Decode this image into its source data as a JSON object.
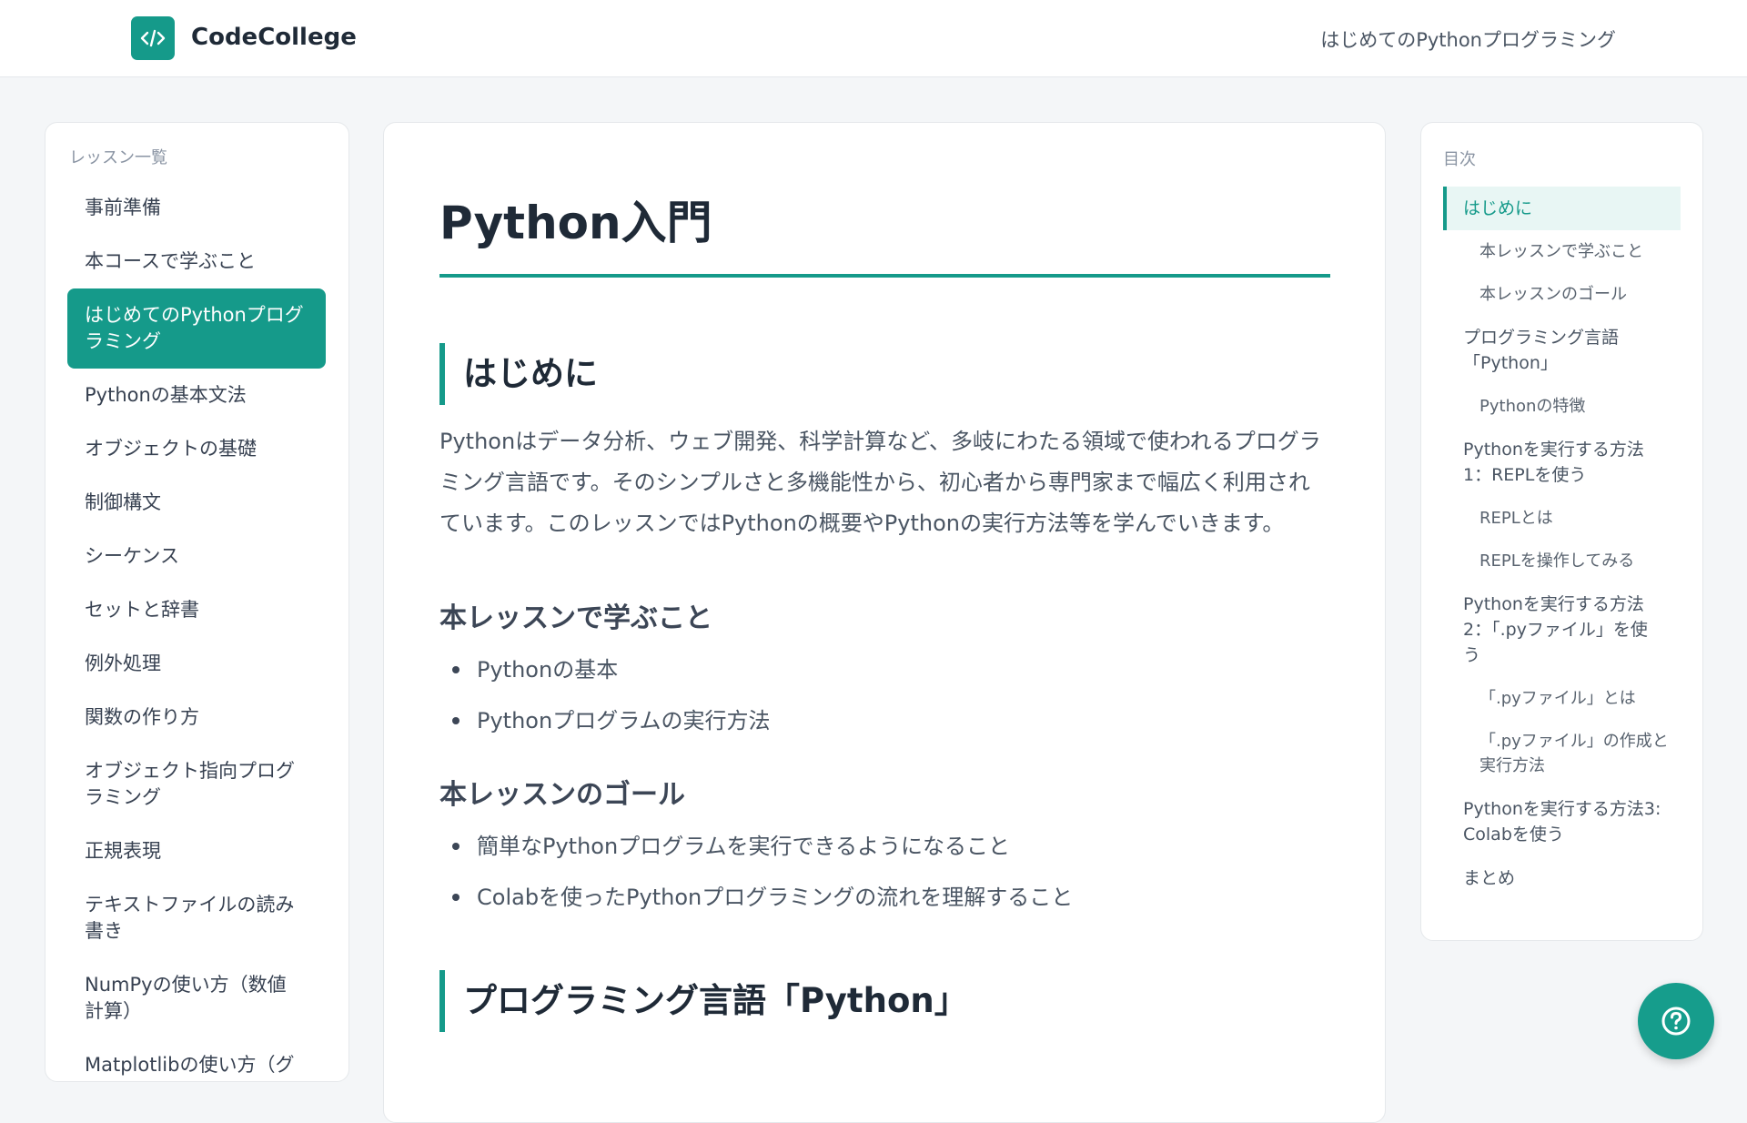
{
  "header": {
    "brand": "CodeCollege",
    "course_title": "はじめてのPythonプログラミング",
    "logo_icon": "code-icon"
  },
  "left_nav": {
    "heading": "レッスン一覧",
    "items": [
      {
        "label": "事前準備"
      },
      {
        "label": "本コースで学ぶこと"
      },
      {
        "label": "はじめてのPythonプログラミング",
        "active": true
      },
      {
        "label": "Pythonの基本文法"
      },
      {
        "label": "オブジェクトの基礎"
      },
      {
        "label": "制御構文"
      },
      {
        "label": "シーケンス"
      },
      {
        "label": "セットと辞書"
      },
      {
        "label": "例外処理"
      },
      {
        "label": "関数の作り方"
      },
      {
        "label": "オブジェクト指向プログラミング"
      },
      {
        "label": "正規表現"
      },
      {
        "label": "テキストファイルの読み書き"
      },
      {
        "label": "NumPyの使い方（数値計算）"
      },
      {
        "label": "Matplotlibの使い方（グラ"
      }
    ]
  },
  "main": {
    "title": "Python入門",
    "section1_heading": "はじめに",
    "intro_paragraph": "Pythonはデータ分析、ウェブ開発、科学計算など、多岐にわたる領域で使われるプログラミング言語です。そのシンプルさと多機能性から、初心者から専門家まで幅広く利用されています。このレッスンではPythonの概要やPythonの実行方法等を学んでいきます。",
    "learn_heading": "本レッスンで学ぶこと",
    "learn_items": [
      "Pythonの基本",
      "Pythonプログラムの実行方法"
    ],
    "goal_heading": "本レッスンのゴール",
    "goal_items": [
      "簡単なPythonプログラムを実行できるようになること",
      "Colabを使ったPythonプログラミングの流れを理解すること"
    ],
    "section2_heading": "プログラミング言語「Python」"
  },
  "toc": {
    "heading": "目次",
    "items": [
      {
        "label": "はじめに",
        "level": 1,
        "active": true
      },
      {
        "label": "本レッスンで学ぶこと",
        "level": 2
      },
      {
        "label": "本レッスンのゴール",
        "level": 2
      },
      {
        "label": "プログラミング言語「Python」",
        "level": 1
      },
      {
        "label": "Pythonの特徴",
        "level": 2
      },
      {
        "label": "Pythonを実行する方法1：REPLを使う",
        "level": 1
      },
      {
        "label": "REPLとは",
        "level": 2
      },
      {
        "label": "REPLを操作してみる",
        "level": 2
      },
      {
        "label": "Pythonを実行する方法2：「.pyファイル」を使う",
        "level": 1
      },
      {
        "label": "「.pyファイル」とは",
        "level": 2
      },
      {
        "label": "「.pyファイル」の作成と実行方法",
        "level": 2
      },
      {
        "label": "Pythonを実行する方法3: Colabを使う",
        "level": 1
      },
      {
        "label": "まとめ",
        "level": 1
      }
    ]
  },
  "help_button": {
    "icon": "help-circle-icon"
  },
  "colors": {
    "accent": "#159a8a",
    "active_bg": "#e8f6f4"
  }
}
